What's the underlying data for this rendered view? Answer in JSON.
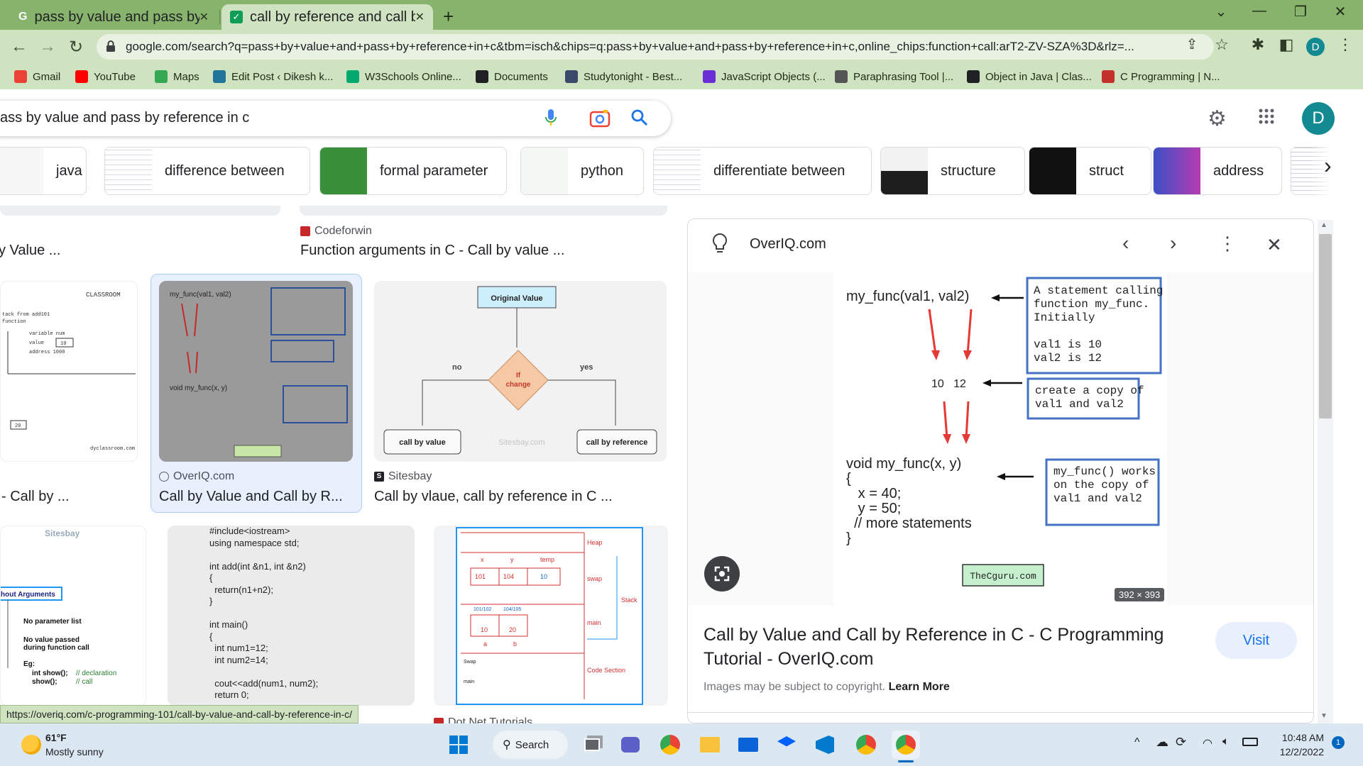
{
  "browser": {
    "tabs": [
      {
        "title": "pass by value and pass by referen",
        "active": false,
        "favicon": "google-icon"
      },
      {
        "title": "call by reference and call by valu",
        "active": true,
        "favicon": "check-icon"
      }
    ],
    "url": "google.com/search?q=pass+by+value+and+pass+by+reference+in+c&tbm=isch&chips=q:pass+by+value+and+pass+by+reference+in+c,online_chips:function+call:arT2-ZV-SZA%3D&rlz=...",
    "profile_initial": "D",
    "bookmarks": [
      {
        "label": "Gmail",
        "icon": "gmail-icon",
        "color": "#ea4335"
      },
      {
        "label": "YouTube",
        "icon": "youtube-icon",
        "color": "#ff0000"
      },
      {
        "label": "Maps",
        "icon": "maps-icon",
        "color": "#34a853"
      },
      {
        "label": "Edit Post ‹ Dikesh k...",
        "icon": "wordpress-icon",
        "color": "#21759b"
      },
      {
        "label": "W3Schools Online...",
        "icon": "w3schools-icon",
        "color": "#04aa6d"
      },
      {
        "label": "Documents",
        "icon": "documents-icon",
        "color": "#202124"
      },
      {
        "label": "Studytonight - Best...",
        "icon": "studytonight-icon",
        "color": "#3b4a6b"
      },
      {
        "label": "JavaScript Objects (...",
        "icon": "javascript-icon",
        "color": "#6b2fd6"
      },
      {
        "label": "Paraphrasing Tool |...",
        "icon": "pen-icon",
        "color": "#555555"
      },
      {
        "label": "Object in Java | Clas...",
        "icon": "globe-icon",
        "color": "#202124"
      },
      {
        "label": "C Programming | N...",
        "icon": "c-icon",
        "color": "#c4302b"
      }
    ]
  },
  "search": {
    "query": "ass by value and pass by reference in c",
    "avatar_initial": "D"
  },
  "chips": [
    {
      "label": "java"
    },
    {
      "label": "difference between"
    },
    {
      "label": "formal parameter"
    },
    {
      "label": "python"
    },
    {
      "label": "differentiate between"
    },
    {
      "label": "structure"
    },
    {
      "label": "struct"
    },
    {
      "label": "address"
    }
  ],
  "results": {
    "row1": [
      {
        "source": "",
        "title": "y Value ..."
      },
      {
        "source": "Codeforwin",
        "title": "Function arguments in C - Call by value ..."
      }
    ],
    "row2": [
      {
        "source": "",
        "title": "- Call by ..."
      },
      {
        "source": "OverIQ.com",
        "title": "Call by Value and Call by R..."
      },
      {
        "source": "Sitesbay",
        "title": "Call by vlaue, call by reference in C ..."
      }
    ],
    "row3_partial_source": "Dot Net Tutorials"
  },
  "thumbs": {
    "flowchart": {
      "top": "Original Value",
      "cond": "If change",
      "no": "no",
      "yes": "yes",
      "left": "call by value",
      "right": "call by reference",
      "wm": "Sitesbay.com"
    },
    "code": [
      "#include<iostream>",
      "using namespace std;",
      "",
      "int add(int &n1, int &n2)",
      "{",
      "  return(n1+n2);",
      "}",
      "",
      "int main()",
      "{",
      "  int num1=12;",
      "  int num2=14;",
      "",
      "  cout<<add(num1, num2);",
      "  return 0;"
    ],
    "without_args": {
      "header": "hout Arguments",
      "l1": "No parameter list",
      "l2": "No value passed",
      "l3": "during function call",
      "l4": "Eg:",
      "l5": "int show();",
      "l6": "show();",
      "c1": "// declaration",
      "c2": "// call",
      "wm": "Sitesbay"
    },
    "memory": {
      "heap": "Heap",
      "swap": "swap",
      "stack": "Stack",
      "main": "main",
      "code": "Code Section",
      "x": "x",
      "y": "y",
      "temp": "temp",
      "v1": "101",
      "v2": "104",
      "v3": "10",
      "a1": "101/102",
      "a2": "104/105",
      "n1": "10",
      "n2": "20",
      "a": "a",
      "b": "b",
      "s1": "Swap",
      "s2": "main"
    },
    "classroom": {
      "brand": "CLASSROOM",
      "l1": "tack from add101",
      "l2": "function",
      "l3": "variable  num",
      "l4": "value",
      "l5": "address  1000",
      "v1": "10",
      "v2": "20",
      "wm": "dyclassroom.com"
    }
  },
  "panel": {
    "site": "OverIQ.com",
    "title": "Call by Value and Call by Reference in C - C Programming Tutorial - OverIQ.com",
    "copyright": "Images may be subject to copyright.",
    "learn_more": "Learn More",
    "visit": "Visit",
    "dimensions": "392 × 393",
    "diagram": {
      "call": "my_func(val1, val2)",
      "box1": [
        "A statement calling",
        "function my_func.",
        "Initially",
        "",
        "val1  is 10",
        "val2  is 12"
      ],
      "copy_vals": "10   12",
      "box2": [
        "create a copy of",
        "val1 and val2"
      ],
      "def": [
        "void my_func(x, y)",
        "{",
        "   x = 40;",
        "   y = 50;",
        "  // more statements",
        "}"
      ],
      "box3": [
        "my_func() works",
        "on the copy of",
        "val1 and val2"
      ],
      "logo": "TheCguru.com"
    }
  },
  "status_url": "https://overiq.com/c-programming-101/call-by-value-and-call-by-reference-in-c/",
  "taskbar": {
    "weather_temp": "61°F",
    "weather_desc": "Mostly sunny",
    "search": "Search",
    "time": "10:48 AM",
    "date": "12/2/2022"
  },
  "colors": {
    "chrome_frame": "#87b36d",
    "chrome_toolbar": "#cfe3c0",
    "link_blue": "#1a73e8",
    "diagram_red": "#e53935",
    "diagram_blue": "#4472c4"
  }
}
